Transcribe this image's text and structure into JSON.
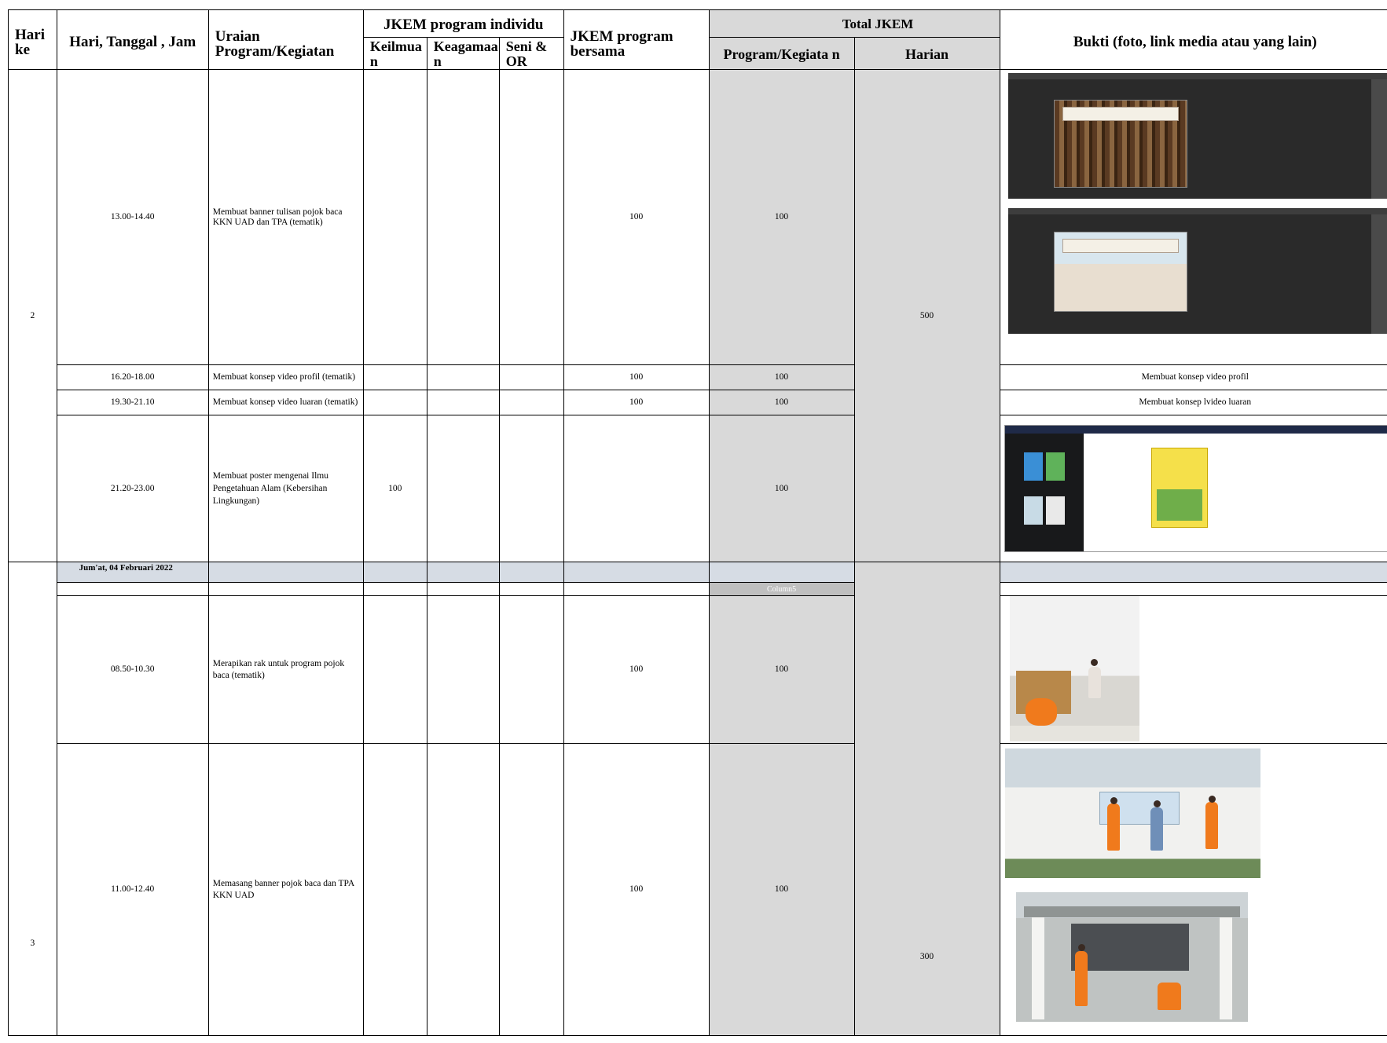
{
  "headers": {
    "hari_ke": "Hari ke",
    "hari_tanggal_jam": "Hari, Tanggal , Jam",
    "uraian": "Uraian Program/Kegiatan",
    "jkem_individu": "JKEM program individu",
    "keilmuan": "Keilmua n",
    "keagamaan": "Keagamaa n",
    "seni_or": "Seni & OR",
    "jkem_bersama": "JKEM program bersama",
    "total_jkem": "Total JKEM",
    "program_kegiatan": "Program/Kegiata n",
    "harian": "Harian",
    "bukti": "Bukti (foto, link media atau yang lain)"
  },
  "day2": {
    "hari_ke": "2",
    "harian": "500",
    "rows": [
      {
        "time": "13.00-14.40",
        "desc": "Membuat banner tulisan pojok baca KKN UAD dan TPA (tematik)",
        "keilmuan": "",
        "bersama": "100",
        "total": "100",
        "evidence_text": "",
        "evidence": [
          "photoshop-library-banner",
          "photoshop-mosque-banner"
        ]
      },
      {
        "time": "16.20-18.00",
        "desc": "Membuat konsep video profil (tematik)",
        "keilmuan": "",
        "bersama": "100",
        "total": "100",
        "evidence_text": "Membuat konsep video profil"
      },
      {
        "time": "19.30-21.10",
        "desc": "Membuat konsep video luaran (tematik)",
        "keilmuan": "",
        "bersama": "100",
        "total": "100",
        "evidence_text": "Membuat konsep lvideo luaran"
      },
      {
        "time": "21.20-23.00",
        "desc": "Membuat poster mengenai Ilmu Pengetahuan Alam (Kebersihan Lingkungan)",
        "keilmuan": "100",
        "bersama": "",
        "total": "100",
        "evidence_text": "",
        "evidence": [
          "canva-poster-editor"
        ]
      }
    ]
  },
  "day3": {
    "hari_ke": "3",
    "date": "Jum'at, 04 Februari 2022",
    "column_label": "Column5",
    "harian": "300",
    "rows": [
      {
        "time": "08.50-10.30",
        "desc": "Merapikan rak untuk program pojok baca (tematik)",
        "bersama": "100",
        "total": "100",
        "evidence": [
          "photo-arranging-shelf"
        ]
      },
      {
        "time": "11.00-12.40",
        "desc": "Memasang banner pojok baca dan TPA KKN UAD",
        "bersama": "100",
        "total": "100",
        "evidence": [
          "photo-installing-banner-wall",
          "photo-installing-banner-gate"
        ]
      }
    ]
  }
}
